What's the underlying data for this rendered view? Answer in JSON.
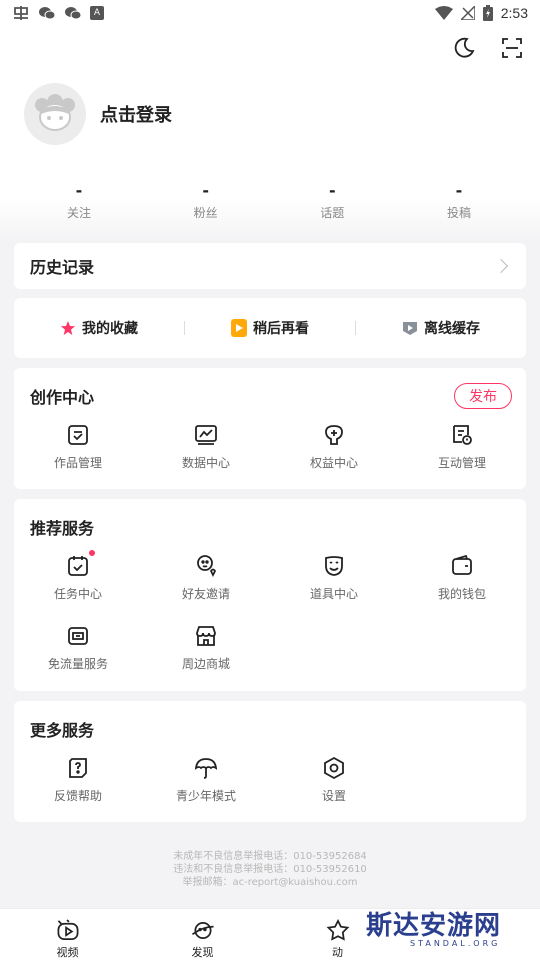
{
  "status_bar": {
    "time": "2:53",
    "left_icons": [
      "notification-icon",
      "wechat-icon",
      "wechat-icon",
      "a-app-icon"
    ],
    "right_icons": [
      "wifi-icon",
      "no-signal-icon",
      "battery-charging-icon"
    ]
  },
  "header": {
    "actions": [
      "dark-mode-icon",
      "scan-icon"
    ]
  },
  "profile": {
    "login_label": "点击登录"
  },
  "stats": [
    {
      "value": "-",
      "label": "关注"
    },
    {
      "value": "-",
      "label": "粉丝"
    },
    {
      "value": "-",
      "label": "话题"
    },
    {
      "value": "-",
      "label": "投稿"
    }
  ],
  "history": {
    "title": "历史记录"
  },
  "quick_links": [
    {
      "label": "我的收藏",
      "icon": "star-icon",
      "color": "#fe3666"
    },
    {
      "label": "稍后再看",
      "icon": "watch-later-icon",
      "color": "#ffa80a"
    },
    {
      "label": "离线缓存",
      "icon": "offline-cache-icon",
      "color": "#8a9099"
    }
  ],
  "creation_center": {
    "title": "创作中心",
    "publish_label": "发布",
    "items": [
      {
        "label": "作品管理",
        "icon": "works-manage-icon"
      },
      {
        "label": "数据中心",
        "icon": "data-center-icon"
      },
      {
        "label": "权益中心",
        "icon": "rights-center-icon"
      },
      {
        "label": "互动管理",
        "icon": "interaction-manage-icon"
      }
    ]
  },
  "recommended_services": {
    "title": "推荐服务",
    "items": [
      {
        "label": "任务中心",
        "icon": "task-center-icon",
        "badge": true
      },
      {
        "label": "好友邀请",
        "icon": "invite-friends-icon"
      },
      {
        "label": "道具中心",
        "icon": "props-center-icon"
      },
      {
        "label": "我的钱包",
        "icon": "wallet-icon"
      },
      {
        "label": "免流量服务",
        "icon": "free-data-icon"
      },
      {
        "label": "周边商城",
        "icon": "shop-icon"
      }
    ]
  },
  "more_services": {
    "title": "更多服务",
    "items": [
      {
        "label": "反馈帮助",
        "icon": "feedback-help-icon"
      },
      {
        "label": "青少年模式",
        "icon": "teen-mode-icon"
      },
      {
        "label": "设置",
        "icon": "settings-icon"
      }
    ]
  },
  "footer": {
    "line1": "未成年不良信息举报电话：010-53952684",
    "line2": "违法和不良信息举报电话：010-53952610",
    "line3": "举报邮箱：ac-report@kuaishou.com"
  },
  "tabbar": [
    {
      "label": "视频",
      "icon": "video-tab-icon"
    },
    {
      "label": "发现",
      "icon": "discover-tab-icon"
    },
    {
      "label": "动",
      "icon": "dynamic-tab-icon"
    },
    {
      "label": "",
      "icon": ""
    }
  ],
  "watermark": {
    "text": "斯达安游网",
    "sub": "STANDAL.ORG"
  },
  "colors": {
    "accent": "#fe3666",
    "orange": "#ffa80a",
    "background": "#f3f3f5"
  }
}
